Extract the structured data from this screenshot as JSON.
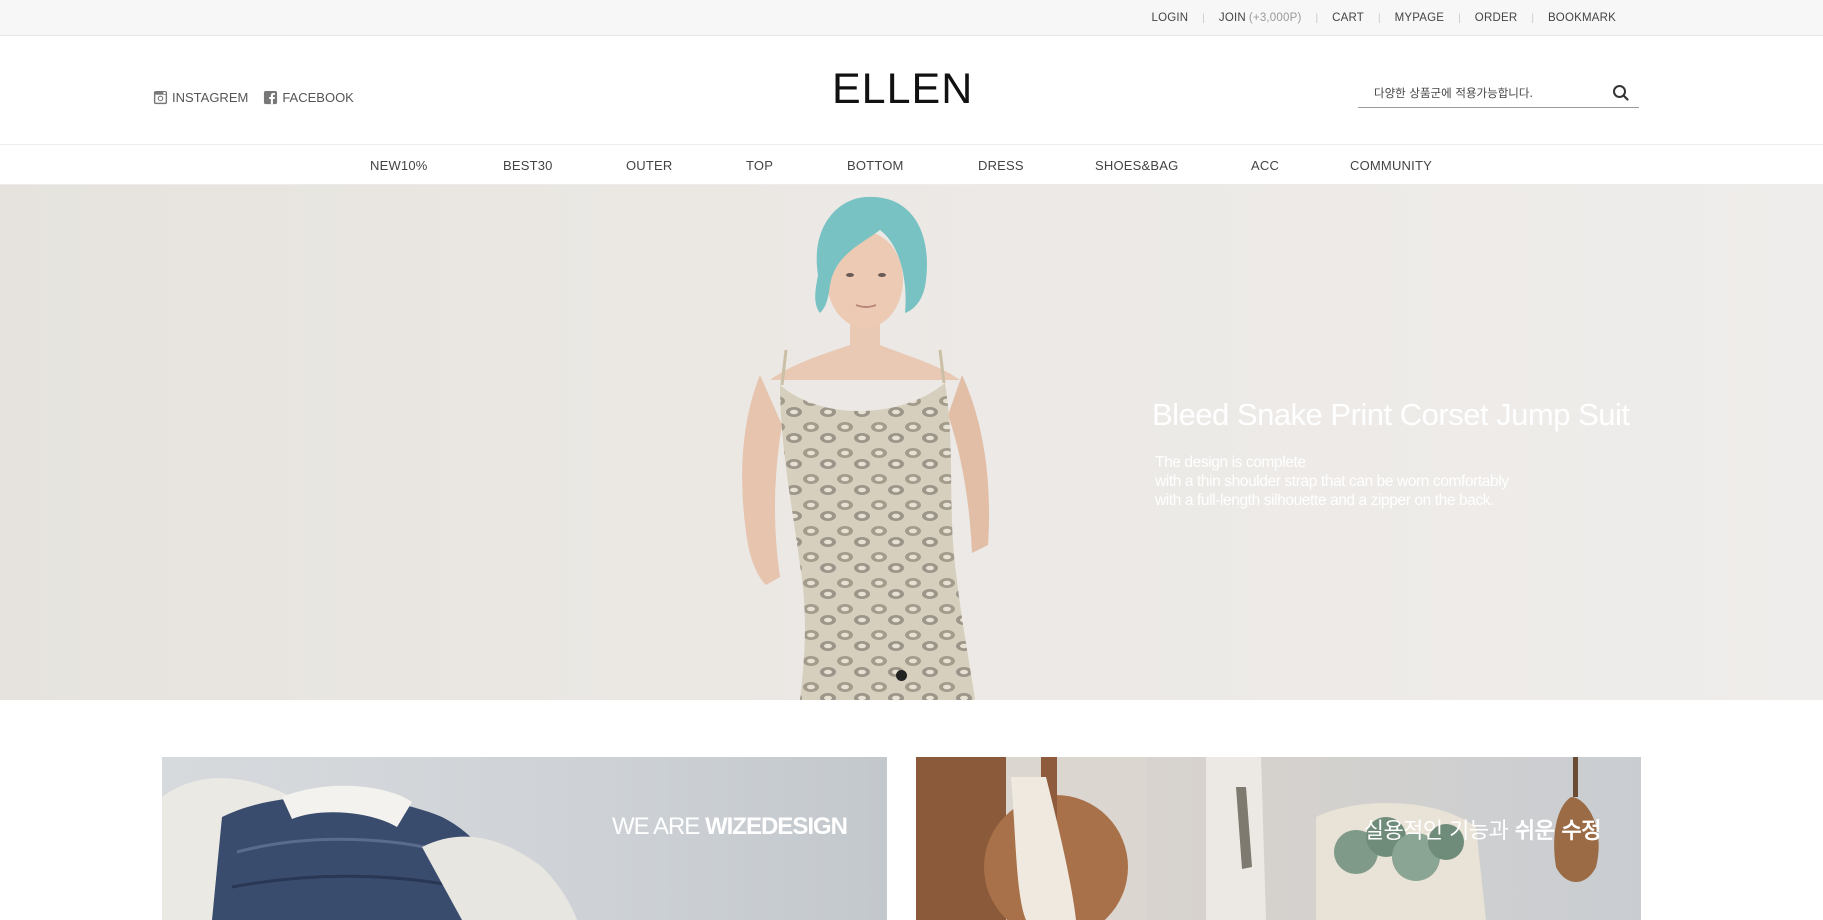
{
  "topbar": {
    "links": [
      {
        "label": "LOGIN"
      },
      {
        "label": "JOIN",
        "bonus": "(+3,000P)"
      },
      {
        "label": "CART"
      },
      {
        "label": "MYPAGE"
      },
      {
        "label": "ORDER"
      },
      {
        "label": "BOOKMARK"
      }
    ]
  },
  "header": {
    "social": [
      {
        "label": "INSTAGREM",
        "icon": "instagram-icon"
      },
      {
        "label": "FACEBOOK",
        "icon": "facebook-icon"
      }
    ],
    "logo": "ELLEN",
    "search": {
      "placeholder": "다양한 상품군에 적용가능합니다.",
      "icon": "search-icon"
    }
  },
  "nav": {
    "items": [
      "NEW10%",
      "BEST30",
      "OUTER",
      "TOP",
      "BOTTOM",
      "DRESS",
      "SHOES&BAG",
      "ACC",
      "COMMUNITY"
    ]
  },
  "hero": {
    "title": "Bleed Snake Print Corset Jump Suit",
    "desc": [
      "The design is complete",
      "with a thin shoulder strap that can be worn comfortably",
      "with a full-length silhouette and a zipper on the back."
    ],
    "slide_count": 1,
    "active_slide": 1
  },
  "banners": [
    {
      "light": "WE ARE ",
      "bold": "WIZEDESIGN"
    },
    {
      "light": "실용적인 기능과 ",
      "bold": "쉬운 수정"
    }
  ],
  "colors": {
    "topbar_bg": "#f7f7f7",
    "text": "#444444",
    "logo": "#111111",
    "hero_text": "#ffffff"
  }
}
